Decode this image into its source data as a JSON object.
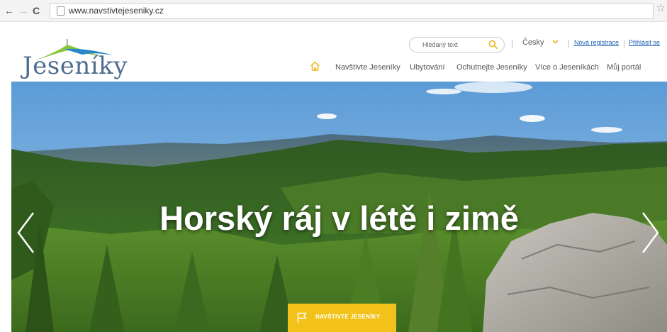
{
  "browser": {
    "back_glyph": "←",
    "forward_glyph": "→",
    "reload_glyph": "C",
    "star_glyph": "☆",
    "url": "www.navstivtejeseniky.cz"
  },
  "site": {
    "logo_text": "Jeseníky",
    "logo_colors": {
      "roof": "#8cc63f",
      "peak": "#2c87c8",
      "text": "#4f6e8e"
    },
    "search": {
      "placeholder": "Hledaný text"
    },
    "separator": "|",
    "language": "Česky",
    "top_links": [
      "Nová registrace",
      "Přihlásit se"
    ],
    "nav": {
      "home_icon": "home-icon",
      "items": [
        "Navštivte Jeseníky",
        "Ubytování",
        "Ochutnejte Jeseníky",
        "Více o Jeseníkách",
        "Můj portál"
      ]
    }
  },
  "hero": {
    "title": "Horský ráj v létě i zimě",
    "cta_label": "NAVŠTIVTE JESENÍKY",
    "cta_color": "#f2c21b",
    "prev_icon": "chevron-left-icon",
    "next_icon": "chevron-right-icon"
  }
}
